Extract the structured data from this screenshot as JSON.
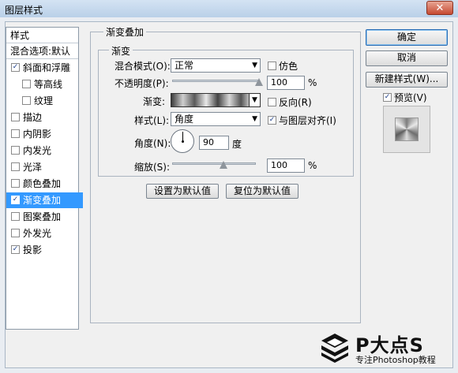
{
  "window": {
    "title": "图层样式",
    "close_glyph": "✕"
  },
  "style_list": {
    "header": "样式",
    "blend_options": "混合选项:默认",
    "items": [
      {
        "label": "斜面和浮雕",
        "checked": true,
        "indent": false,
        "selected": false
      },
      {
        "label": "等高线",
        "checked": false,
        "indent": true,
        "selected": false
      },
      {
        "label": "纹理",
        "checked": false,
        "indent": true,
        "selected": false
      },
      {
        "label": "描边",
        "checked": false,
        "indent": false,
        "selected": false
      },
      {
        "label": "内阴影",
        "checked": false,
        "indent": false,
        "selected": false
      },
      {
        "label": "内发光",
        "checked": false,
        "indent": false,
        "selected": false
      },
      {
        "label": "光泽",
        "checked": false,
        "indent": false,
        "selected": false
      },
      {
        "label": "颜色叠加",
        "checked": false,
        "indent": false,
        "selected": false
      },
      {
        "label": "渐变叠加",
        "checked": true,
        "indent": false,
        "selected": true
      },
      {
        "label": "图案叠加",
        "checked": false,
        "indent": false,
        "selected": false
      },
      {
        "label": "外发光",
        "checked": false,
        "indent": false,
        "selected": false
      },
      {
        "label": "投影",
        "checked": true,
        "indent": false,
        "selected": false
      }
    ]
  },
  "panel": {
    "outer_title": "渐变叠加",
    "inner_title": "渐变",
    "blend_mode": {
      "label": "混合模式(O):",
      "value": "正常"
    },
    "dither": {
      "label": "仿色",
      "checked": false
    },
    "opacity": {
      "label": "不透明度(P):",
      "value": "100",
      "unit": "%",
      "level": 1.0
    },
    "gradient": {
      "label": "渐变:"
    },
    "reverse": {
      "label": "反向(R)",
      "checked": false
    },
    "style": {
      "label": "样式(L):",
      "value": "角度"
    },
    "align_layer": {
      "label": "与图层对齐(I)",
      "checked": true
    },
    "angle": {
      "label": "角度(N):",
      "value": "90",
      "unit": "度"
    },
    "scale": {
      "label": "缩放(S):",
      "value": "100",
      "unit": "%",
      "level": 0.5
    },
    "set_default": "设置为默认值",
    "reset_default": "复位为默认值"
  },
  "buttons": {
    "ok": "确定",
    "cancel": "取消",
    "new_style": "新建样式(W)...",
    "preview": {
      "label": "预览(V)",
      "checked": true
    }
  },
  "watermark": {
    "brand": "P大点S",
    "tagline": "专注Photoshop教程"
  },
  "colors": {
    "selection": "#3399ff",
    "titlebar": "#c4d9ee",
    "close": "#c64a32"
  }
}
